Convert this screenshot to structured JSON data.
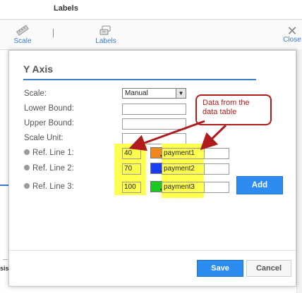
{
  "app": {
    "title": "Labels",
    "toolbar": {
      "scale_label": "Scale",
      "labels_label": "Labels",
      "close_label": "Close"
    },
    "background_axis_fragment": "sis"
  },
  "dialog": {
    "title": "Y Axis",
    "fields": {
      "scale_label": "Scale:",
      "scale_value": "Manual",
      "lower_bound_label": "Lower Bound:",
      "lower_bound_value": "",
      "upper_bound_label": "Upper Bound:",
      "upper_bound_value": "",
      "scale_unit_label": "Scale Unit:",
      "scale_unit_value": ""
    },
    "ref_lines": [
      {
        "label": "Ref. Line 1:",
        "value": "40",
        "color": "#f0861e",
        "field": "payment1"
      },
      {
        "label": "Ref. Line 2:",
        "value": "70",
        "color": "#1a3ff2",
        "field": "payment2"
      },
      {
        "label": "Ref. Line 3:",
        "value": "100",
        "color": "#1ec81e",
        "field": "payment3"
      }
    ],
    "add_label": "Add",
    "save_label": "Save",
    "cancel_label": "Cancel"
  },
  "annotation": {
    "callout_text": "Data from the data table",
    "colors": {
      "callout": "#b01c1c",
      "highlight": "#ffff4d"
    }
  },
  "colors": {
    "accent": "#2d8cf0",
    "rule": "#3a7ad0"
  }
}
